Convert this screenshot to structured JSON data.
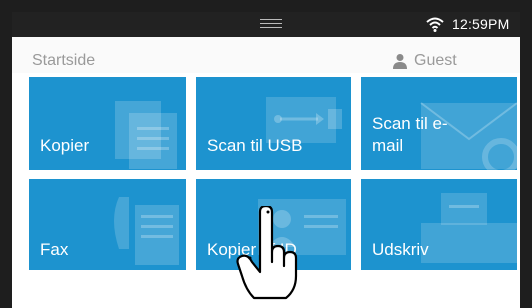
{
  "status_bar": {
    "time": "12:59PM",
    "wifi_icon": "wifi-icon",
    "handle_icon": "drag-handle-icon"
  },
  "header": {
    "title": "Startside",
    "user_icon": "user-icon",
    "user_label": "Guest"
  },
  "tiles": [
    {
      "label": "Kopier",
      "icon": "copy-icon"
    },
    {
      "label": "Scan til USB",
      "icon": "usb-icon"
    },
    {
      "label": "Scan til e-\nmail",
      "icon": "email-icon"
    },
    {
      "label": "Fax",
      "icon": "fax-icon"
    },
    {
      "label": "Kopier af ID",
      "icon": "id-card-icon"
    },
    {
      "label": "Udskriv",
      "icon": "printer-icon"
    }
  ],
  "colors": {
    "tile": "#1d93cf",
    "status_bar": "#222222",
    "frame": "#1e1e1e",
    "text_muted": "#9a9a9a"
  },
  "overlay": {
    "pointer_icon": "pointing-hand-icon"
  }
}
